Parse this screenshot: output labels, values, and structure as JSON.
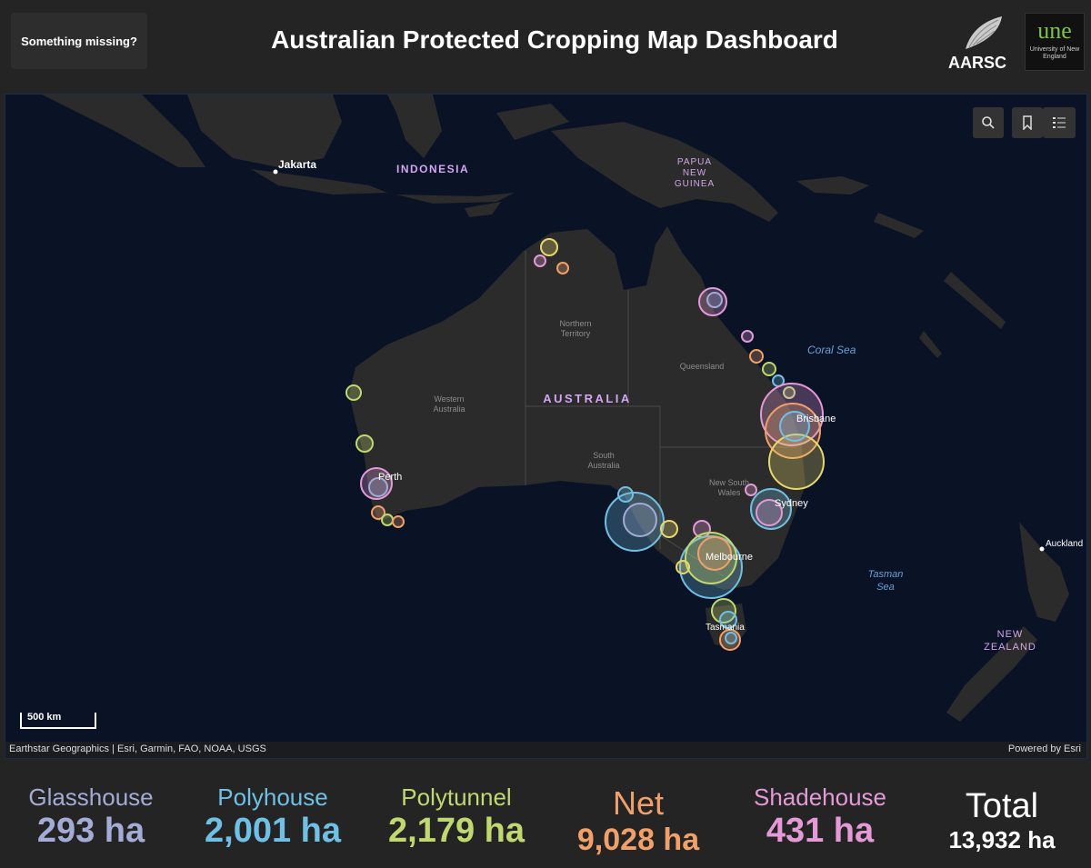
{
  "header": {
    "missing_button": "Something missing?",
    "title": "Australian Protected Cropping Map Dashboard",
    "logo_aarsc": "AARSC",
    "logo_une": "une",
    "logo_une_sub": "University of New England"
  },
  "map": {
    "labels": {
      "jakarta": "Jakarta",
      "indonesia": "INDONESIA",
      "png_1": "PAPUA",
      "png_2": "NEW",
      "png_3": "GUINEA",
      "coral_sea": "Coral Sea",
      "northern_territory_1": "Northern",
      "northern_territory_2": "Territory",
      "queensland": "Queensland",
      "western_australia_1": "Western",
      "western_australia_2": "Australia",
      "australia": "AUSTRALIA",
      "south_australia_1": "South",
      "south_australia_2": "Australia",
      "nsw_1": "New South",
      "nsw_2": "Wales",
      "brisbane": "Brisbane",
      "sydney": "Sydney",
      "perth": "Perth",
      "melbourne": "Melbourne",
      "tasmania": "Tasmania",
      "tasman_1": "Tasman",
      "tasman_2": "Sea",
      "auckland": "Auckland",
      "nz_1": "NEW",
      "nz_2": "ZEALAND"
    },
    "scale": "500 km",
    "attribution_left": "Earthstar Geographics | Esri, Garmin, FAO, NOAA, USGS",
    "attribution_right": "Powered by Esri",
    "tools": [
      "search-icon",
      "bookmark-icon",
      "legend-icon"
    ]
  },
  "stats": [
    {
      "label": "Glasshouse",
      "value": "293 ha",
      "color": "#a3acd4"
    },
    {
      "label": "Polyhouse",
      "value": "2,001 ha",
      "color": "#6fc0e4"
    },
    {
      "label": "Polytunnel",
      "value": "2,179 ha",
      "color": "#c0d870"
    },
    {
      "label": "Net",
      "value": "9,028 ha",
      "color": "#f2a06a"
    },
    {
      "label": "Shadehouse",
      "value": "431 ha",
      "color": "#e49ad6"
    },
    {
      "label": "Total",
      "value": "13,932 ha",
      "color": "#ffffff"
    }
  ]
}
